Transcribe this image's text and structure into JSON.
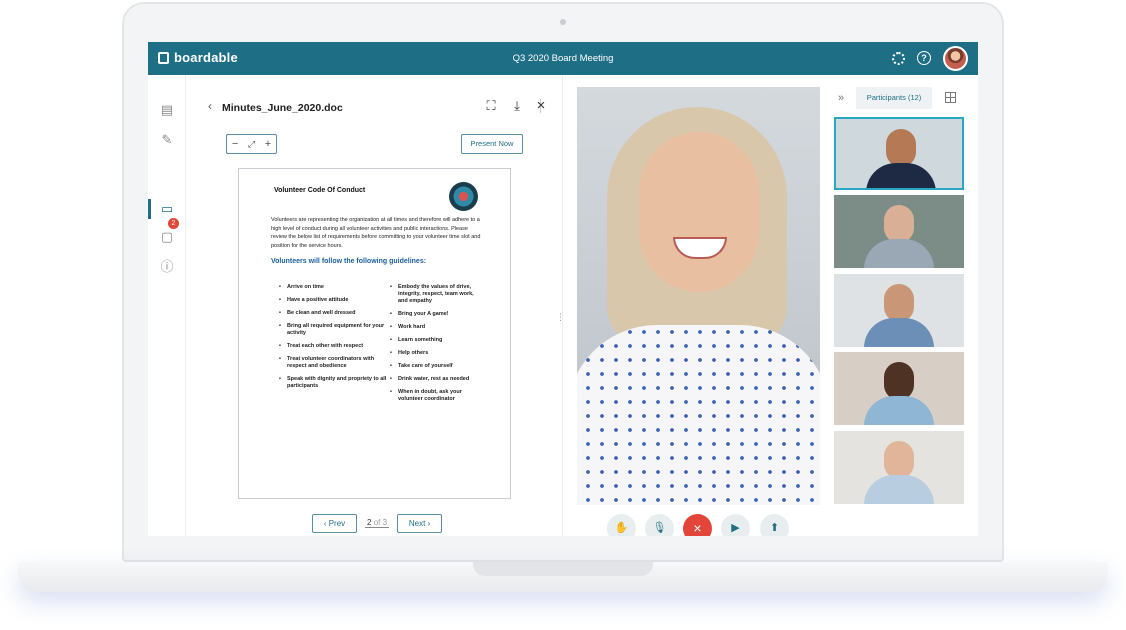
{
  "app": {
    "brand": "boardable",
    "meeting_title": "Q3 2020 Board Meeting"
  },
  "header_icons": [
    "gear-icon",
    "help-icon"
  ],
  "help_glyph": "?",
  "rail": {
    "unread_count": "2"
  },
  "document": {
    "file_name": "Minutes_June_2020.doc",
    "present_label": "Present Now",
    "page_title": "Volunteer Code Of Conduct",
    "intro": "Volunteers are representing the organization at all times and therefore will adhere to a high level of conduct during all volunteer activities and public interactions. Please review the below list of requirements before committing to your volunteer time slot and position for the service hours.",
    "guidelines_heading": "Volunteers will follow the following guidelines:",
    "left_list": [
      "Arrive on time",
      "Have a positive attitude",
      "Be clean and well dressed",
      "Bring all required equipment for your activity",
      "Treat each other with respect",
      "Treat volunteer coordinators with respect and obedience",
      "Speak with dignity and propriety to all participants"
    ],
    "right_list": [
      "Embody the values of drive, integrity, respect, team work, and empathy",
      "Bring your A game!",
      "Work hard",
      "Learn something",
      "Help others",
      "Take care of yourself",
      "Drink water, rest as needed",
      "When in doubt, ask your volunteer coordinator"
    ],
    "pager": {
      "prev": "Prev",
      "next": "Next",
      "current": "2",
      "of_total": "of 3"
    }
  },
  "participants": {
    "tab_label": "Participants (12)"
  },
  "colors": {
    "brand": "#1e6f86",
    "end_call": "#e2453a",
    "active_thumb": "#2aa7c0"
  }
}
